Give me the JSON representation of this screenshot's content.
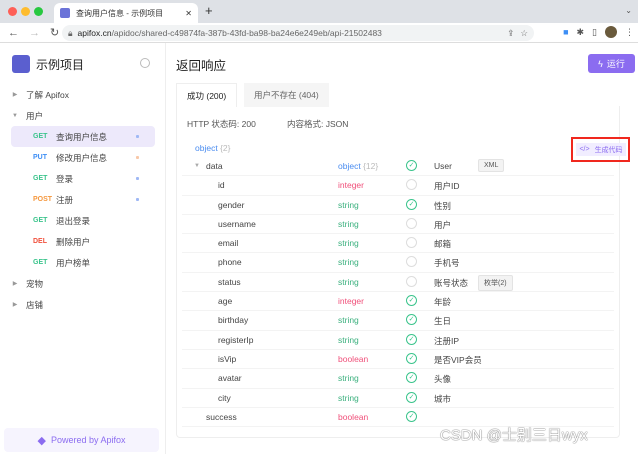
{
  "browser": {
    "tab_title": "查询用户信息 - 示例项目",
    "url_host": "apifox.cn",
    "url_path": "/apidoc/shared-c49874fa-387b-43fd-ba98-ba24e6e249eb/api-21502483"
  },
  "sidebar": {
    "project": "示例项目",
    "items": [
      {
        "type": "folder",
        "label": "了解 Apifox",
        "open": false
      },
      {
        "type": "folder",
        "label": "用户",
        "open": true
      },
      {
        "type": "api",
        "method": "GET",
        "label": "查询用户信息",
        "selected": true,
        "dot": "#9fb8f5"
      },
      {
        "type": "api",
        "method": "PUT",
        "label": "修改用户信息",
        "dot": "#f8c8a8"
      },
      {
        "type": "api",
        "method": "GET",
        "label": "登录",
        "dot": "#9fb8f5"
      },
      {
        "type": "api",
        "method": "POST",
        "label": "注册",
        "dot": "#9fb8f5"
      },
      {
        "type": "api",
        "method": "GET",
        "label": "退出登录"
      },
      {
        "type": "api",
        "method": "DEL",
        "label": "删除用户"
      },
      {
        "type": "api",
        "method": "GET",
        "label": "用户榜单"
      },
      {
        "type": "folder",
        "label": "宠物",
        "open": false
      },
      {
        "type": "folder",
        "label": "店铺",
        "open": false
      }
    ],
    "powered": "Powered by Apifox"
  },
  "colors": {
    "GET": "#3bc48c",
    "PUT": "#3d8ef5",
    "POST": "#f5973d",
    "DEL": "#f0503c",
    "integer": "#f0507a",
    "boolean": "#f0507a",
    "string": "#3bb07e",
    "object": "#4a8cf0"
  },
  "main": {
    "title": "返回响应",
    "run": "运行",
    "tabs": [
      "成功 (200)",
      "用户不存在 (404)"
    ],
    "status": "HTTP 状态码: 200",
    "format": "内容格式: JSON",
    "root_type": "object",
    "root_count": "{2}",
    "gen_code": "生成代码",
    "rows": [
      {
        "name": "data",
        "type": "object",
        "count": "{12}",
        "req": true,
        "desc": "User",
        "tag": "XML",
        "level": 1,
        "expand": true
      },
      {
        "name": "id",
        "type": "integer",
        "req": false,
        "desc": "用户ID",
        "level": 2
      },
      {
        "name": "gender",
        "type": "string",
        "req": true,
        "desc": "性别",
        "level": 2
      },
      {
        "name": "username",
        "type": "string",
        "req": false,
        "desc": "用户",
        "level": 2
      },
      {
        "name": "email",
        "type": "string",
        "req": false,
        "desc": "邮箱",
        "level": 2
      },
      {
        "name": "phone",
        "type": "string",
        "req": false,
        "desc": "手机号",
        "level": 2
      },
      {
        "name": "status",
        "type": "string",
        "req": false,
        "desc": "账号状态",
        "tag": "枚举(2)",
        "level": 2
      },
      {
        "name": "age",
        "type": "integer",
        "req": true,
        "desc": "年龄",
        "level": 2
      },
      {
        "name": "birthday",
        "type": "string",
        "req": true,
        "desc": "生日",
        "level": 2
      },
      {
        "name": "registerIp",
        "type": "string",
        "req": true,
        "desc": "注册IP",
        "level": 2
      },
      {
        "name": "isVip",
        "type": "boolean",
        "req": true,
        "desc": "是否VIP会员",
        "level": 2
      },
      {
        "name": "avatar",
        "type": "string",
        "req": true,
        "desc": "头像",
        "level": 2
      },
      {
        "name": "city",
        "type": "string",
        "req": true,
        "desc": "城市",
        "level": 2
      },
      {
        "name": "success",
        "type": "boolean",
        "req": true,
        "desc": "",
        "level": 1
      }
    ]
  },
  "watermark": "CSDN @士别三日wyx"
}
